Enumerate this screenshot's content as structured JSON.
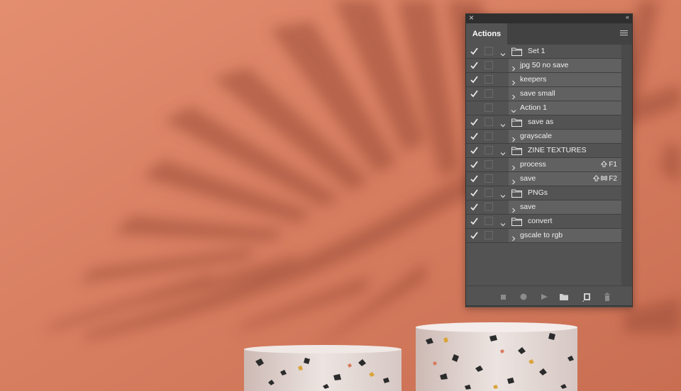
{
  "panel": {
    "tab_label": "Actions",
    "close_glyph": "×",
    "collapse_glyph": "‹‹",
    "rows": [
      {
        "type": "set",
        "label": "Set 1",
        "checked": true,
        "expanded": true,
        "shortcut": ""
      },
      {
        "type": "action",
        "label": "jpg 50 no save",
        "checked": true,
        "expanded": false,
        "shortcut": ""
      },
      {
        "type": "action",
        "label": "keepers",
        "checked": true,
        "expanded": false,
        "shortcut": ""
      },
      {
        "type": "action",
        "label": "save small",
        "checked": true,
        "expanded": false,
        "shortcut": ""
      },
      {
        "type": "action",
        "label": "Action 1",
        "checked": false,
        "expanded": true,
        "shortcut": ""
      },
      {
        "type": "set",
        "label": "save as",
        "checked": true,
        "expanded": true,
        "shortcut": ""
      },
      {
        "type": "action",
        "label": "grayscale",
        "checked": true,
        "expanded": false,
        "shortcut": ""
      },
      {
        "type": "set",
        "label": "ZINE TEXTURES",
        "checked": true,
        "expanded": true,
        "shortcut": ""
      },
      {
        "type": "action",
        "label": "process",
        "checked": true,
        "expanded": false,
        "shortcut": "F1",
        "modifiers": [
          "shift"
        ]
      },
      {
        "type": "action",
        "label": "save",
        "checked": true,
        "expanded": false,
        "shortcut": "F2",
        "modifiers": [
          "shift",
          "cmd"
        ]
      },
      {
        "type": "set",
        "label": "PNGs",
        "checked": true,
        "expanded": true,
        "shortcut": ""
      },
      {
        "type": "action",
        "label": "save",
        "checked": true,
        "expanded": false,
        "shortcut": ""
      },
      {
        "type": "set",
        "label": "convert",
        "checked": true,
        "expanded": true,
        "shortcut": ""
      },
      {
        "type": "action",
        "label": "gscale to rgb",
        "checked": true,
        "expanded": false,
        "shortcut": ""
      }
    ],
    "bottom_buttons": [
      {
        "name": "stop-playing-button",
        "icon": "stop-icon"
      },
      {
        "name": "begin-recording-button",
        "icon": "record-icon"
      },
      {
        "name": "play-selection-button",
        "icon": "play-icon"
      },
      {
        "name": "create-new-set-button",
        "icon": "folder-icon"
      },
      {
        "name": "create-new-action-button",
        "icon": "new-action-icon"
      },
      {
        "name": "delete-button",
        "icon": "trash-icon"
      }
    ]
  },
  "colors": {
    "wall": "#d98064",
    "panel_bg": "#535353",
    "action_row_bg": "#616161",
    "titlebar": "#2f2f2f"
  }
}
